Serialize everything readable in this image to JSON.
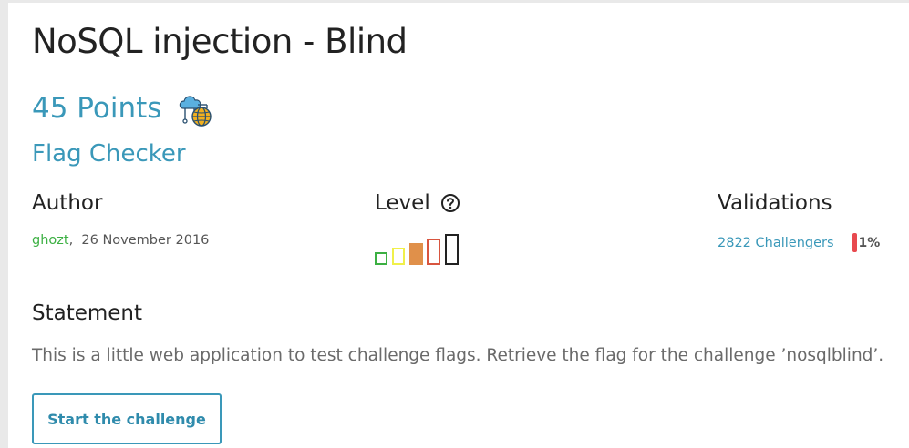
{
  "challenge": {
    "title": "NoSQL injection - Blind",
    "points": "45 Points",
    "category_icon": "web-server-globe-icon",
    "validation": "Flag Checker"
  },
  "author": {
    "heading": "Author",
    "name": "ghozt",
    "separator": ",",
    "date": "26 November 2016"
  },
  "level": {
    "heading": "Level",
    "help_icon": "question-circle-icon",
    "filled_bars": 3,
    "bar_colors": [
      "#3cb043",
      "#f0f04a",
      "#e0904a",
      "#d8553f",
      "#222222"
    ]
  },
  "validations": {
    "heading": "Validations",
    "challengers": "2822 Challengers",
    "percent": "1%",
    "bar_color": "#e8494f"
  },
  "statement": {
    "heading": "Statement",
    "text": "This is a little web application to test challenge flags. Retrieve the flag for the challenge ’nosqlblind’."
  },
  "actions": {
    "start_label": "Start the challenge"
  },
  "colors": {
    "accent": "#3a98b9",
    "author": "#3cb043"
  }
}
